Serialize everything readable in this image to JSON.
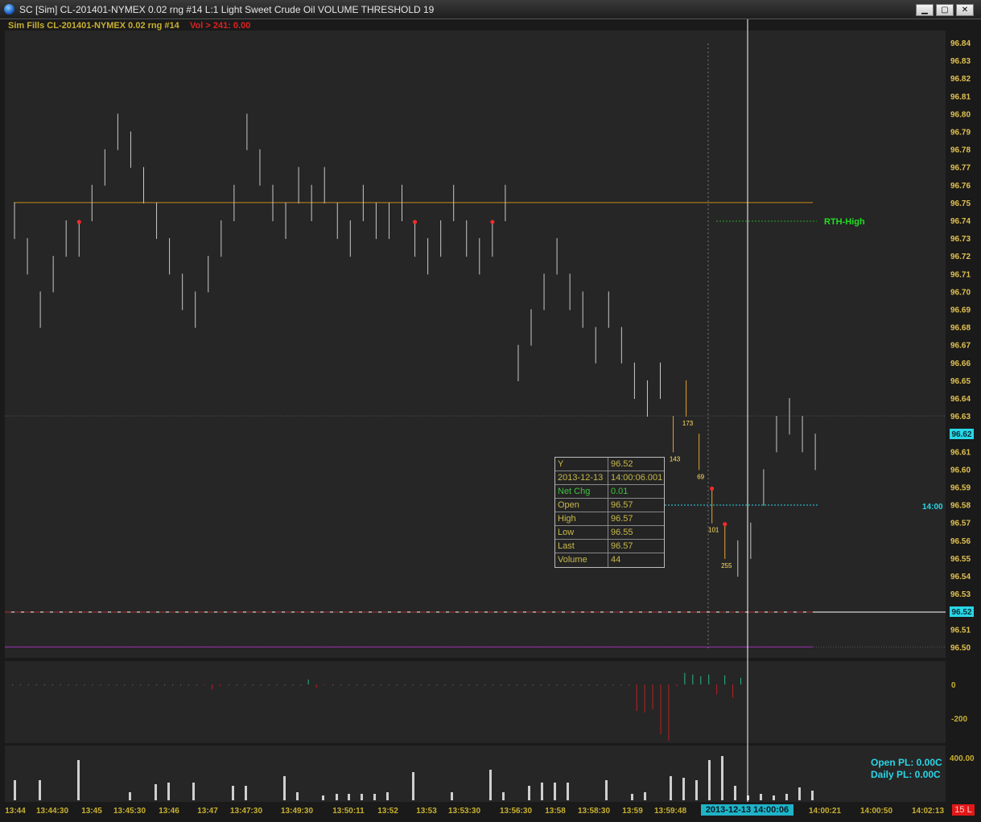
{
  "window": {
    "title": "SC [Sim] CL-201401-NYMEX  0.02 rng  #14  L:1  Light Sweet Crude Oil  VOLUME THRESHOLD 19",
    "minimize": "▁",
    "maximize": "▢",
    "close": "✕"
  },
  "header": {
    "study": "Sim Fills  CL-201401-NYMEX  0.02 rng  #14",
    "vol": "Vol > 241: 0.00"
  },
  "colors": {
    "bg": "#262626",
    "bars": "#c8c8c8",
    "fills": "#e8a030",
    "priceAxis": "#e0c050",
    "cyan": "#29d6e6",
    "rth": "#22dd22"
  },
  "annotations": {
    "rth_high": "RTH-High",
    "marker_1400": "14:00",
    "current_price": "96.62",
    "cursor_price": "96.52",
    "fill_labels": [
      "143",
      "173",
      "69",
      "101",
      "255"
    ]
  },
  "tooltip": {
    "rows": [
      {
        "k": "Y",
        "v": "96.52"
      },
      {
        "k": "2013-12-13",
        "v": "14:00:06.001"
      },
      {
        "k": "Net Chg",
        "v": "0.01"
      },
      {
        "k": "Open",
        "v": "96.57"
      },
      {
        "k": "High",
        "v": "96.57"
      },
      {
        "k": "Low",
        "v": "96.55"
      },
      {
        "k": "Last",
        "v": "96.57"
      },
      {
        "k": "Volume",
        "v": "44"
      }
    ]
  },
  "delta_axis": [
    "0",
    "-200"
  ],
  "volume_axis": [
    "400.00"
  ],
  "pl": {
    "open": "Open PL: 0.00C",
    "daily": "Daily PL: 0.00C"
  },
  "time_axis": [
    "13:44",
    "13:44:30",
    "13:45",
    "13:45:30",
    "13:46",
    "13:47",
    "13:47:30",
    "13:49:30",
    "13:50:11",
    "13:52",
    "13:53",
    "13:53:30",
    "13:56:30",
    "13:58",
    "13:58:30",
    "13:59",
    "13:59:48",
    "14:00:21",
    "14:00:50",
    "14:02:13"
  ],
  "time_badge": "2013-12-13  14:00:06",
  "l_badge": "15 L",
  "chart_data": {
    "type": "bar",
    "title": "CL-201401-NYMEX 0.02 rng",
    "price_ticks": [
      "96.84",
      "96.83",
      "96.82",
      "96.81",
      "96.80",
      "96.79",
      "96.78",
      "96.77",
      "96.76",
      "96.75",
      "96.74",
      "96.73",
      "96.72",
      "96.71",
      "96.70",
      "96.69",
      "96.68",
      "96.67",
      "96.66",
      "96.65",
      "96.64",
      "96.63",
      "96.62",
      "96.61",
      "96.60",
      "96.59",
      "96.58",
      "96.57",
      "96.56",
      "96.55",
      "96.54",
      "96.53",
      "96.52",
      "96.51",
      "96.50"
    ],
    "ylim": [
      96.49,
      96.85
    ],
    "levels": {
      "rth_high": 96.75,
      "low_line": 96.5,
      "current": 96.62
    },
    "bars": [
      [
        96.75,
        96.73
      ],
      [
        96.73,
        96.71
      ],
      [
        96.7,
        96.68
      ],
      [
        96.72,
        96.7
      ],
      [
        96.74,
        96.72
      ],
      [
        96.74,
        96.72
      ],
      [
        96.76,
        96.74
      ],
      [
        96.78,
        96.76
      ],
      [
        96.8,
        96.78
      ],
      [
        96.79,
        96.77
      ],
      [
        96.77,
        96.75
      ],
      [
        96.75,
        96.73
      ],
      [
        96.73,
        96.71
      ],
      [
        96.71,
        96.69
      ],
      [
        96.7,
        96.68
      ],
      [
        96.72,
        96.7
      ],
      [
        96.74,
        96.72
      ],
      [
        96.76,
        96.74
      ],
      [
        96.8,
        96.78
      ],
      [
        96.78,
        96.76
      ],
      [
        96.76,
        96.74
      ],
      [
        96.75,
        96.73
      ],
      [
        96.77,
        96.75
      ],
      [
        96.76,
        96.74
      ],
      [
        96.77,
        96.75
      ],
      [
        96.75,
        96.73
      ],
      [
        96.74,
        96.72
      ],
      [
        96.76,
        96.74
      ],
      [
        96.75,
        96.73
      ],
      [
        96.75,
        96.73
      ],
      [
        96.76,
        96.74
      ],
      [
        96.74,
        96.72
      ],
      [
        96.73,
        96.71
      ],
      [
        96.74,
        96.72
      ],
      [
        96.76,
        96.74
      ],
      [
        96.74,
        96.72
      ],
      [
        96.73,
        96.71
      ],
      [
        96.74,
        96.72
      ],
      [
        96.76,
        96.74
      ],
      [
        96.67,
        96.65
      ],
      [
        96.69,
        96.67
      ],
      [
        96.71,
        96.69
      ],
      [
        96.73,
        96.71
      ],
      [
        96.71,
        96.69
      ],
      [
        96.7,
        96.68
      ],
      [
        96.68,
        96.66
      ],
      [
        96.7,
        96.68
      ],
      [
        96.68,
        96.66
      ],
      [
        96.66,
        96.64
      ],
      [
        96.65,
        96.63
      ],
      [
        96.66,
        96.64
      ],
      [
        96.63,
        96.61
      ],
      [
        96.65,
        96.63
      ],
      [
        96.62,
        96.6
      ],
      [
        96.59,
        96.57
      ],
      [
        96.57,
        96.55
      ],
      [
        96.56,
        96.54
      ],
      [
        96.57,
        96.55
      ],
      [
        96.6,
        96.58
      ],
      [
        96.63,
        96.61
      ],
      [
        96.64,
        96.62
      ],
      [
        96.63,
        96.61
      ],
      [
        96.62,
        96.6
      ]
    ],
    "fill_bars": [
      51,
      52,
      53,
      54,
      55
    ],
    "markers": [
      5,
      31,
      37,
      54,
      55
    ],
    "delta": [
      0,
      0,
      0,
      0,
      0,
      0,
      0,
      0,
      0,
      0,
      0,
      0,
      0,
      0,
      0,
      0,
      0,
      0,
      0,
      0,
      0,
      0,
      0,
      0,
      -5,
      -30,
      -10,
      0,
      0,
      0,
      0,
      0,
      0,
      0,
      0,
      0,
      0,
      30,
      -20,
      -5,
      0,
      0,
      0,
      0,
      0,
      0,
      0,
      0,
      0,
      0,
      0,
      0,
      0,
      0,
      0,
      0,
      0,
      0,
      0,
      0,
      0,
      0,
      0,
      0,
      0,
      0,
      0,
      0,
      0,
      0,
      0,
      0,
      0,
      0,
      0,
      0,
      0,
      0,
      -160,
      -170,
      -150,
      -300,
      -340,
      -10,
      70,
      60,
      50,
      60,
      -60,
      55,
      -80,
      40
    ],
    "delta_ylim": [
      -350,
      80
    ],
    "volume": [
      130,
      120,
      240,
      0,
      0,
      0,
      0,
      0,
      0,
      0,
      0,
      0,
      0,
      0,
      0,
      0,
      0,
      0,
      0,
      0,
      0,
      0,
      0,
      0,
      0,
      0,
      0,
      0,
      0,
      0,
      0,
      0,
      0,
      0,
      0,
      0,
      0,
      0,
      0,
      0,
      0,
      0,
      0
    ],
    "volume_ylim": [
      0,
      420
    ]
  }
}
